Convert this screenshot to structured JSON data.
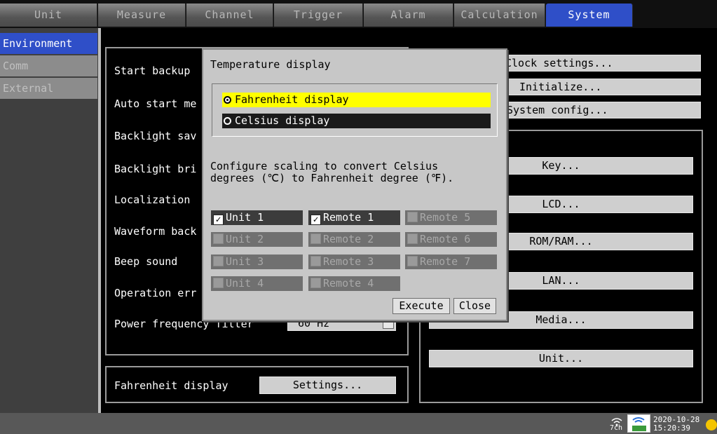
{
  "tabs": [
    {
      "label": "Unit"
    },
    {
      "label": "Measure"
    },
    {
      "label": "Channel"
    },
    {
      "label": "Trigger"
    },
    {
      "label": "Alarm"
    },
    {
      "label": "Calculation"
    },
    {
      "label": "System"
    }
  ],
  "sidebar": {
    "items": [
      {
        "label": "Environment"
      },
      {
        "label": "Comm"
      },
      {
        "label": "External"
      }
    ]
  },
  "left_panel": {
    "labels": [
      "Start backup",
      "Auto start me",
      "Backlight sav",
      "Backlight bri",
      "Localization",
      "Waveform back",
      "Beep sound",
      "Operation err",
      "Power frequency filter"
    ],
    "power_value": "60 Hz"
  },
  "fahrenheit": {
    "label": "Fahrenheit display",
    "button": "Settings..."
  },
  "right_buttons": [
    "Clock settings...",
    "Initialize...",
    "System config..."
  ],
  "right_group": [
    "Key...",
    "LCD...",
    "ROM/RAM...",
    "LAN...",
    "Media...",
    "Unit..."
  ],
  "dialog": {
    "title": "Temperature display",
    "options": [
      {
        "label": "Fahrenheit display",
        "selected": true
      },
      {
        "label": "Celsius display",
        "selected": false
      }
    ],
    "desc_line1": "Configure scaling to convert Celsius",
    "desc_line2": "degrees (℃) to Fahrenheit degree (℉).",
    "checkboxes": [
      {
        "label": "Unit 1",
        "checked": true,
        "enabled": true
      },
      {
        "label": "Unit 2",
        "checked": false,
        "enabled": false
      },
      {
        "label": "Unit 3",
        "checked": false,
        "enabled": false
      },
      {
        "label": "Unit 4",
        "checked": false,
        "enabled": false
      },
      {
        "label": "Remote 1",
        "checked": true,
        "enabled": true
      },
      {
        "label": "Remote 2",
        "checked": false,
        "enabled": false
      },
      {
        "label": "Remote 3",
        "checked": false,
        "enabled": false
      },
      {
        "label": "Remote 4",
        "checked": false,
        "enabled": false
      },
      {
        "label": "Remote 5",
        "checked": false,
        "enabled": false
      },
      {
        "label": "Remote 6",
        "checked": false,
        "enabled": false
      },
      {
        "label": "Remote 7",
        "checked": false,
        "enabled": false
      }
    ],
    "execute": "Execute",
    "close": "Close"
  },
  "status": {
    "channels": "7ch",
    "date": "2020-10-28",
    "time": "15:20:39"
  },
  "colors": {
    "accent": "#2f4fc8",
    "highlight": "#ffff00"
  }
}
